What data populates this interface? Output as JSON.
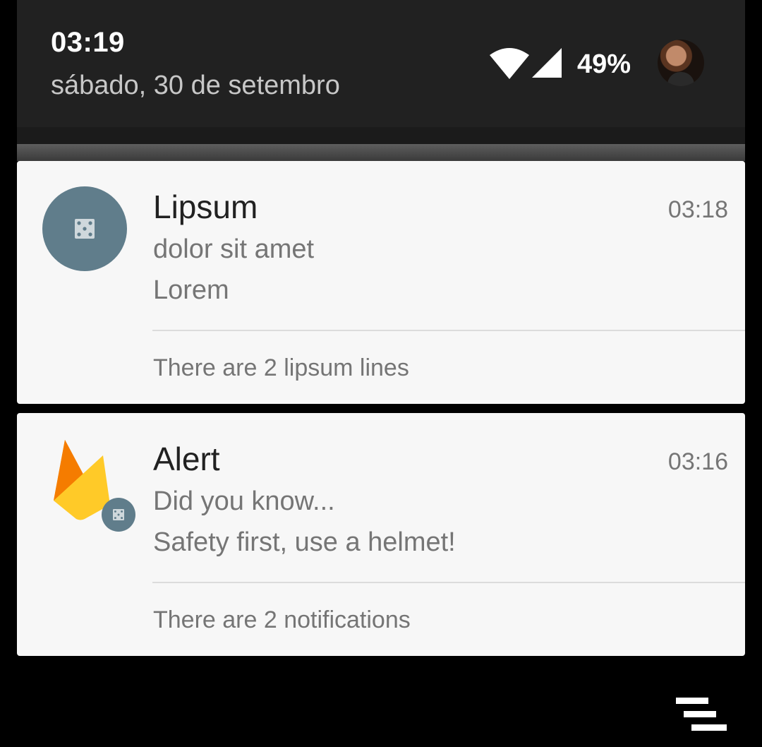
{
  "status": {
    "time": "03:19",
    "date": "sábado, 30 de setembro",
    "battery": "49%",
    "icons": [
      "wifi-icon",
      "signal-icon",
      "avatar"
    ]
  },
  "notifications": [
    {
      "app_icon": "dice-icon",
      "title": "Lipsum",
      "time": "03:18",
      "line1": "dolor sit amet",
      "line2": "Lorem",
      "summary": "There are 2 lipsum lines"
    },
    {
      "app_icon": "firebase-icon",
      "badge_icon": "dice-icon",
      "title": "Alert",
      "time": "03:16",
      "line1": "Did you know...",
      "line2": "Safety first, use a helmet!",
      "summary": "There are 2 notifications"
    }
  ],
  "colors": {
    "header_bg": "#212121",
    "card_bg": "#f7f7f7",
    "app_circle": "#607d8b",
    "firebase_yellow": "#ffca28",
    "firebase_orange": "#ffa000",
    "firebase_dark_orange": "#f57c00"
  },
  "footer": {
    "icon": "clear-all-icon"
  }
}
